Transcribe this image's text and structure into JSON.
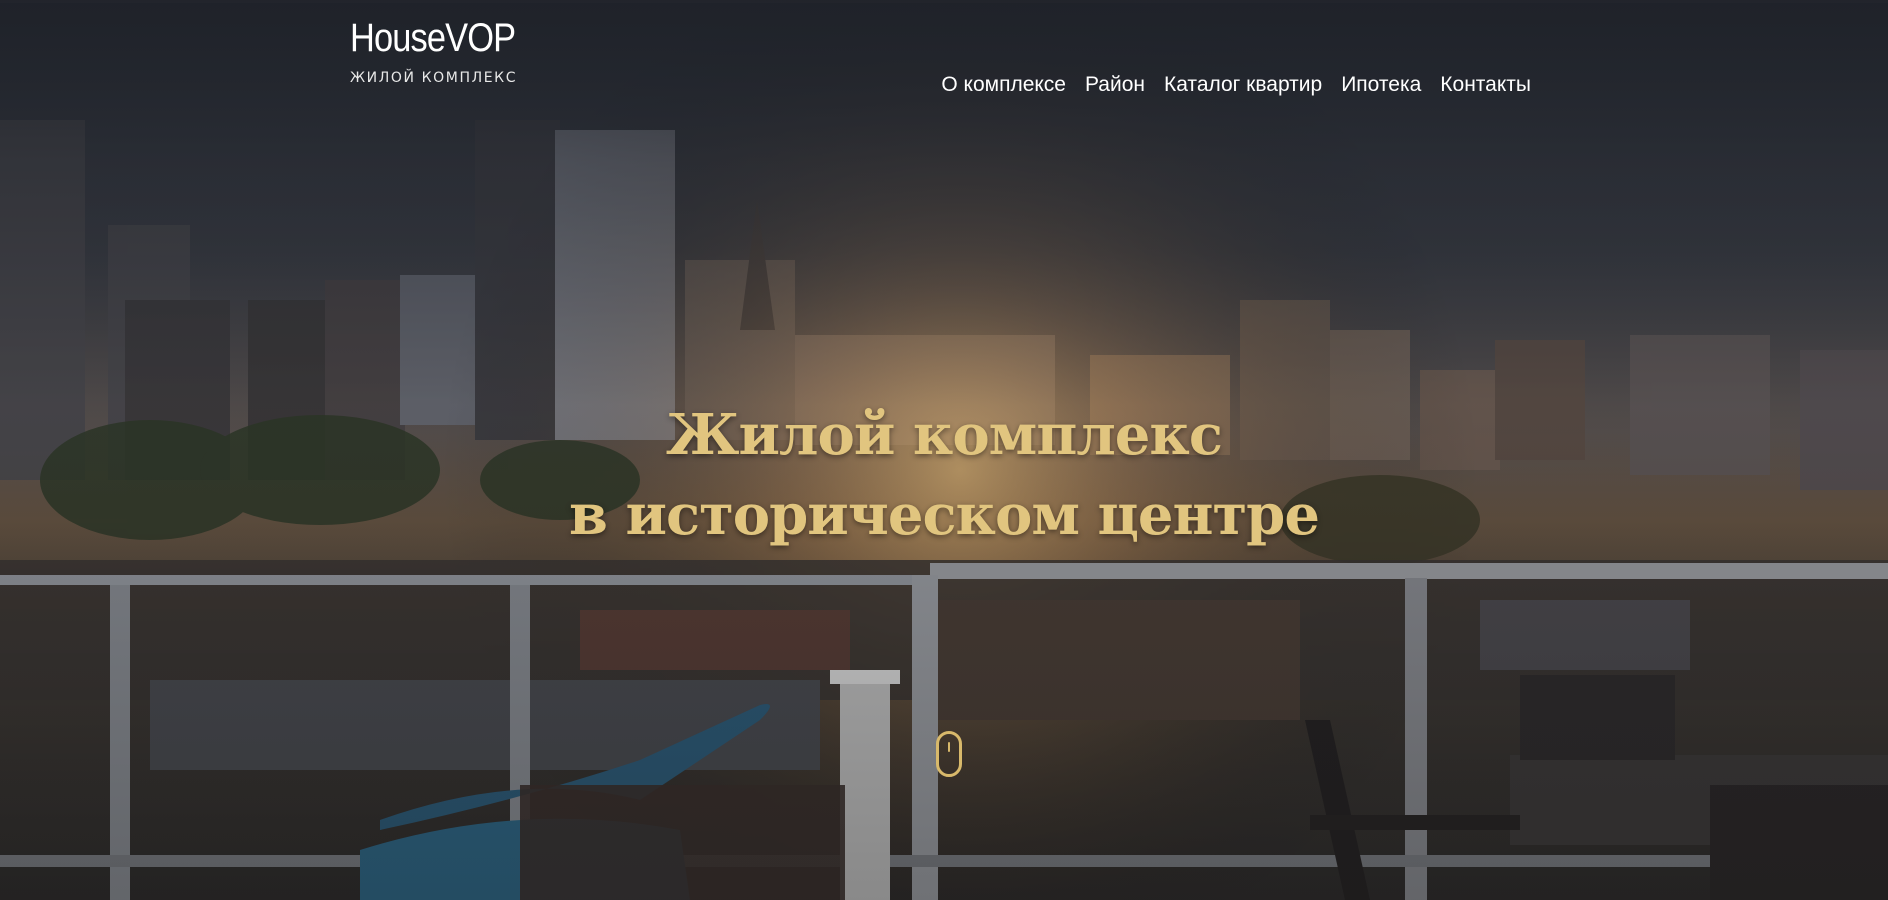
{
  "header": {
    "logo": "HouseVOP",
    "logo_subtitle": "ЖИЛОЙ КОМПЛЕКС"
  },
  "nav": {
    "items": [
      {
        "label": "О комплексе"
      },
      {
        "label": "Район"
      },
      {
        "label": "Каталог квартир"
      },
      {
        "label": "Ипотека"
      },
      {
        "label": "Контакты"
      }
    ]
  },
  "hero": {
    "title_line1": "Жилой комплекс",
    "title_line2": "в историческом центре",
    "scroll_icon": "mouse-scroll-icon"
  },
  "colors": {
    "accent": "#e1c57f",
    "header_bg": "#2b3039",
    "nav_text": "#ffffff"
  }
}
